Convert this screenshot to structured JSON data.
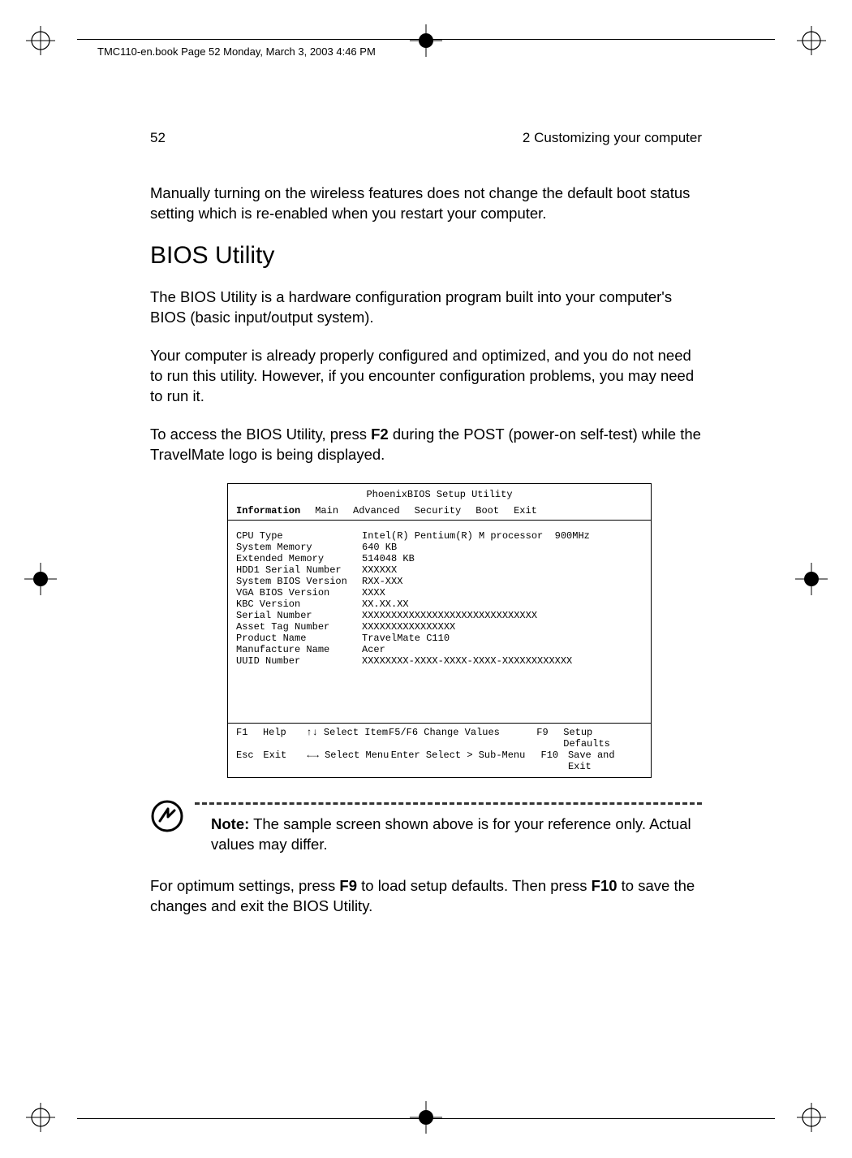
{
  "crop": {
    "book_header": "TMC110-en.book  Page 52  Monday, March 3, 2003  4:46 PM"
  },
  "header": {
    "page_number": "52",
    "chapter": "2 Customizing your computer"
  },
  "paragraphs": {
    "p1": "Manually turning on the wireless features does not change the default boot status setting which is re-enabled when you restart your computer.",
    "title": "BIOS Utility",
    "p2": "The BIOS Utility is a hardware configuration program built into your computer's BIOS (basic input/output system).",
    "p3": "Your computer is already properly configured and optimized, and you do not need to run this utility.  However, if you encounter configuration problems, you may need to run it.",
    "p4_a": "To access the BIOS Utility, press ",
    "p4_key": "F2",
    "p4_b": " during the POST (power-on self-test) while the TravelMate logo is being displayed.",
    "note_label": "Note:",
    "note_text": "  The sample screen shown above is for your reference only. Actual values may differ.",
    "p5_a": "For optimum settings, press ",
    "p5_k1": "F9",
    "p5_b": " to load setup defaults.  Then press ",
    "p5_k2": "F10",
    "p5_c": " to save the changes and exit the BIOS Utility."
  },
  "bios": {
    "title": "PhoenixBIOS Setup Utility",
    "tabs": [
      "Information",
      "Main",
      "Advanced",
      "Security",
      "Boot",
      "Exit"
    ],
    "rows": [
      {
        "label": "CPU Type",
        "value": "Intel(R) Pentium(R) M processor  900MHz"
      },
      {
        "label": "System Memory",
        "value": "640 KB"
      },
      {
        "label": "Extended Memory",
        "value": "514048 KB"
      },
      {
        "label": "HDD1 Serial Number",
        "value": "XXXXXX"
      },
      {
        "label": "System BIOS Version",
        "value": "RXX-XXX"
      },
      {
        "label": "VGA BIOS Version",
        "value": "XXXX"
      },
      {
        "label": "KBC Version",
        "value": "XX.XX.XX"
      },
      {
        "label": "Serial Number",
        "value": "XXXXXXXXXXXXXXXXXXXXXXXXXXXXXX"
      },
      {
        "label": "Asset Tag Number",
        "value": "XXXXXXXXXXXXXXXX"
      },
      {
        "label": "Product Name",
        "value": "TravelMate C110"
      },
      {
        "label": "Manufacture Name",
        "value": "Acer"
      },
      {
        "label": "UUID Number",
        "value": "XXXXXXXX-XXXX-XXXX-XXXX-XXXXXXXXXXXX"
      }
    ],
    "footer": {
      "r1": {
        "k1": "F1",
        "a1": "Help",
        "arrow": "↑↓ Select Item",
        "mid": "F5/F6 Change Values",
        "k2": "F9",
        "a2": "Setup Defaults"
      },
      "r2": {
        "k1": "Esc",
        "a1": "Exit",
        "arrow": "←→ Select Menu",
        "mid": "Enter Select > Sub-Menu",
        "k2": "F10",
        "a2": "Save and Exit"
      }
    }
  }
}
